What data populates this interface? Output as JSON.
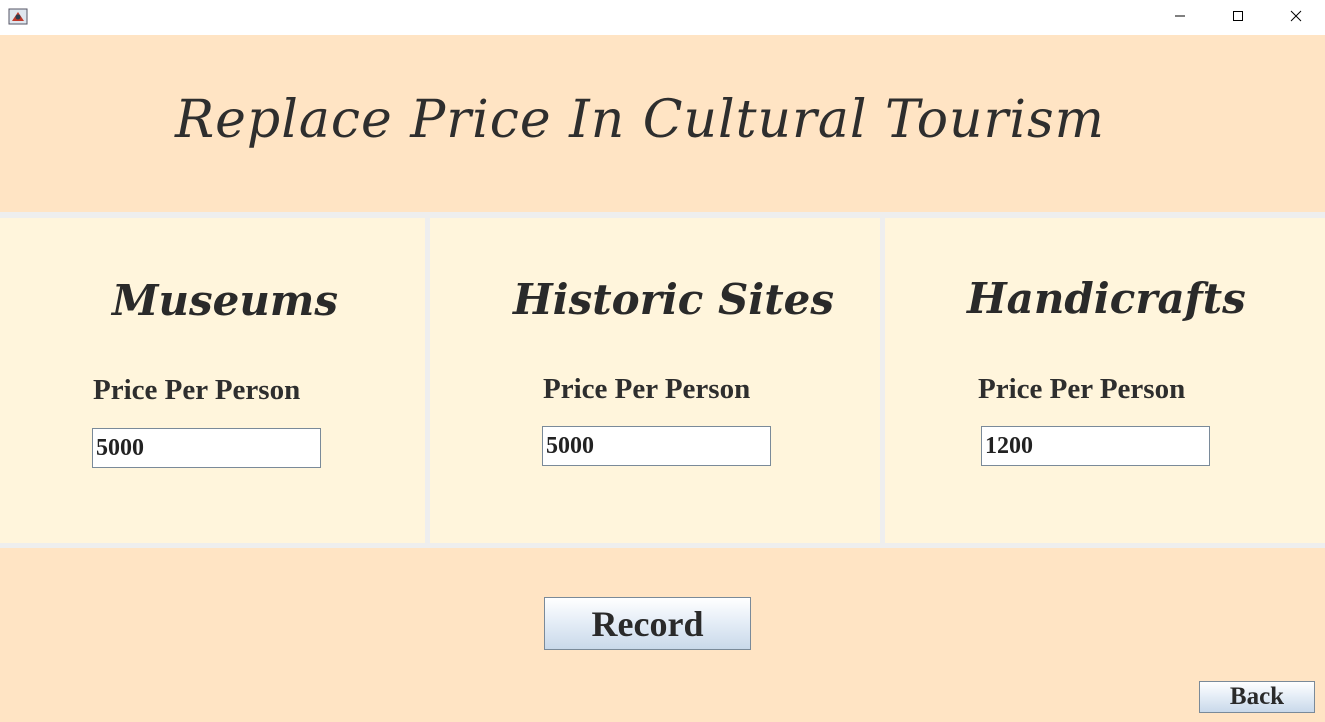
{
  "window": {
    "controls": {
      "minimize_icon": "minimize-icon",
      "maximize_icon": "maximize-icon",
      "close_icon": "close-icon"
    }
  },
  "header": {
    "title": "Replace Price In Cultural Tourism"
  },
  "panels": [
    {
      "title": "Museums",
      "price_label": "Price Per Person",
      "price_value": "5000"
    },
    {
      "title": "Historic Sites",
      "price_label": "Price Per Person",
      "price_value": "5000"
    },
    {
      "title": "Handicrafts",
      "price_label": "Price Per Person",
      "price_value": "1200"
    }
  ],
  "actions": {
    "record_label": "Record",
    "back_label": "Back"
  },
  "colors": {
    "header_bg": "#ffe4c4",
    "panel_bg": "#fff5dc",
    "separator": "#eeeeee"
  }
}
